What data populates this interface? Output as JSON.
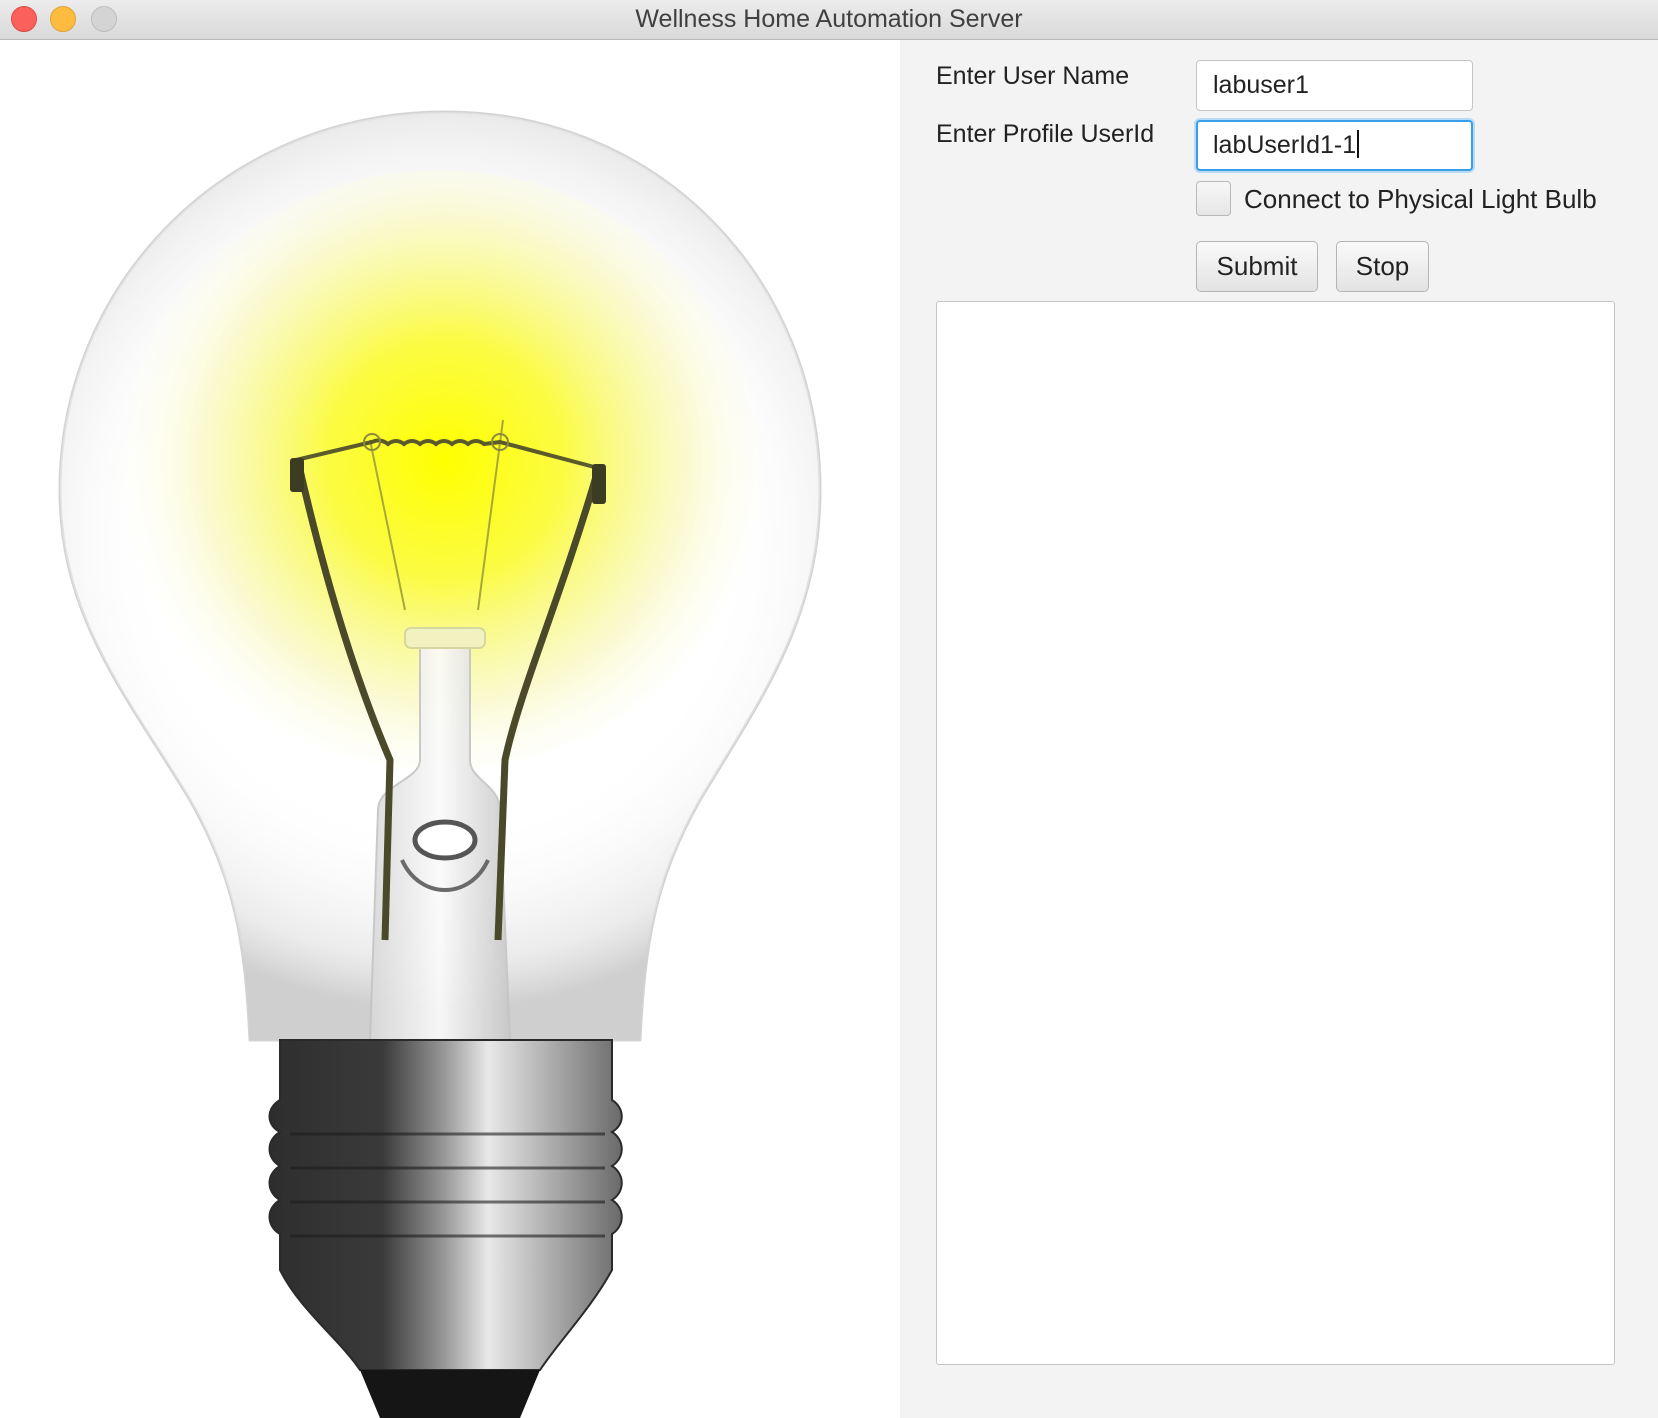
{
  "window": {
    "title": "Wellness Home Automation Server"
  },
  "image": {
    "subject": "light-bulb",
    "glow_color": "#ffff00"
  },
  "form": {
    "user_name_label": "Enter User Name",
    "user_name_value": "labuser1",
    "profile_userid_label": "Enter Profile UserId",
    "profile_userid_value": "labUserId1-1",
    "connect_checkbox_label": "Connect to Physical Light Bulb",
    "connect_checked": false,
    "submit_label": "Submit",
    "stop_label": "Stop"
  },
  "output": {
    "text": ""
  },
  "colors": {
    "focus_ring": "#3a9fe6",
    "close": "#fc605c",
    "minimize": "#fdbc40",
    "maximize": "#d4d4d4"
  }
}
